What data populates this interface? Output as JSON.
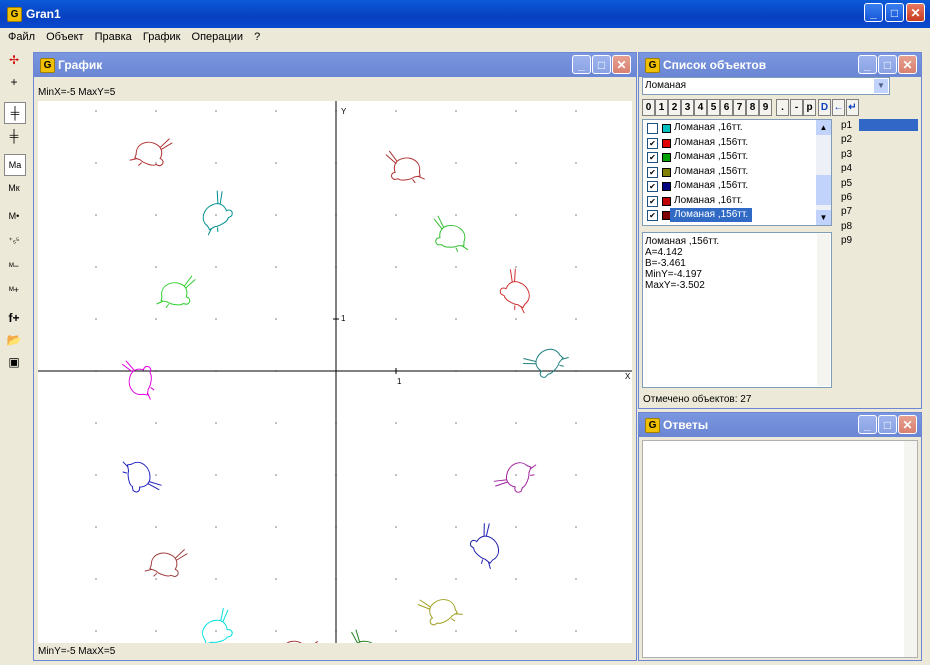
{
  "app": {
    "title": "Gran1"
  },
  "menu": [
    "Файл",
    "Объект",
    "Правка",
    "График",
    "Операции",
    "?"
  ],
  "graph": {
    "title": "График",
    "top_status": "MinX=-5  MaxY=5",
    "bottom_status": "MinY=-5  MaxX=5",
    "axis_y": "Y",
    "axis_x": "X",
    "tick_x": "1",
    "tick_y": "1"
  },
  "objects": {
    "title": "Список объектов",
    "dropdown": "Ломаная",
    "buttons": [
      "0",
      "1",
      "2",
      "3",
      "4",
      "5",
      "6",
      "7",
      "8",
      "9",
      ".",
      "-",
      "p",
      "D",
      "←",
      "↵"
    ],
    "items": [
      {
        "label": "Ломаная ,16тт.",
        "checked": false,
        "color": "#00c0c0"
      },
      {
        "label": "Ломаная ,156тт.",
        "checked": true,
        "color": "#e00000"
      },
      {
        "label": "Ломаная ,156тт.",
        "checked": true,
        "color": "#00a000"
      },
      {
        "label": "Ломаная ,156тт.",
        "checked": true,
        "color": "#808000"
      },
      {
        "label": "Ломаная ,156тт.",
        "checked": true,
        "color": "#000080"
      },
      {
        "label": "Ломаная ,16тт.",
        "checked": true,
        "color": "#c00000"
      },
      {
        "label": "Ломаная ,156тт.",
        "checked": true,
        "color": "#800000"
      }
    ],
    "params": [
      "p1",
      "p2",
      "p3",
      "p4",
      "p5",
      "p6",
      "p7",
      "p8",
      "p9"
    ],
    "info": [
      "Ломаная ,156тт.",
      "A=4.142",
      "B=-3.461",
      "MinY=-4.197",
      "MaxY=-3.502"
    ],
    "status": "Отмечено объектов: 27"
  },
  "answers": {
    "title": "Ответы"
  },
  "rabbits": [
    {
      "color": "#b03030",
      "flip": false
    },
    {
      "color": "#009090",
      "flip": false
    },
    {
      "color": "#30d030",
      "flip": false
    },
    {
      "color": "#e000e0",
      "flip": false
    },
    {
      "color": "#2020c0",
      "flip": false
    },
    {
      "color": "#a04040",
      "flip": false
    },
    {
      "color": "#00e0e0",
      "flip": false
    },
    {
      "color": "#a03030",
      "flip": false
    },
    {
      "color": "#b03030",
      "flip": true
    },
    {
      "color": "#30c030",
      "flip": true
    },
    {
      "color": "#d03030",
      "flip": true
    },
    {
      "color": "#208080",
      "flip": true
    },
    {
      "color": "#a020a0",
      "flip": true
    },
    {
      "color": "#2020b0",
      "flip": true
    },
    {
      "color": "#a0a020",
      "flip": true
    },
    {
      "color": "#208020",
      "flip": true
    }
  ]
}
